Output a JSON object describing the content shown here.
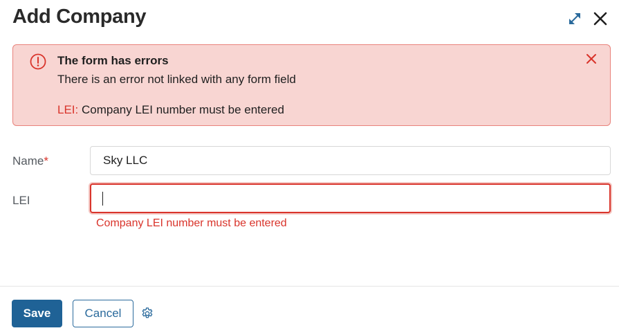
{
  "dialog": {
    "title": "Add Company"
  },
  "header_icons": {
    "expand": "expand-icon",
    "close": "close-icon"
  },
  "alert": {
    "title": "The form has errors",
    "message": "There is an error not linked with any form field",
    "field_name": "LEI:",
    "field_message": " Company LEI number must be entered",
    "icon": "alert-circle-icon",
    "close_icon": "close-icon"
  },
  "form": {
    "name_label": "Name",
    "name_required_mark": "*",
    "name_value": "Sky LLC",
    "lei_label": "LEI",
    "lei_value": "",
    "lei_error": "Company LEI number must be entered"
  },
  "footer": {
    "save_label": "Save",
    "cancel_label": "Cancel",
    "settings_icon": "gear-icon"
  },
  "colors": {
    "primary": "#1f6296",
    "error": "#d9342b",
    "alert_bg": "#f8d5d2",
    "alert_border": "#e8827b",
    "expand_icon": "#2a6a9c"
  }
}
